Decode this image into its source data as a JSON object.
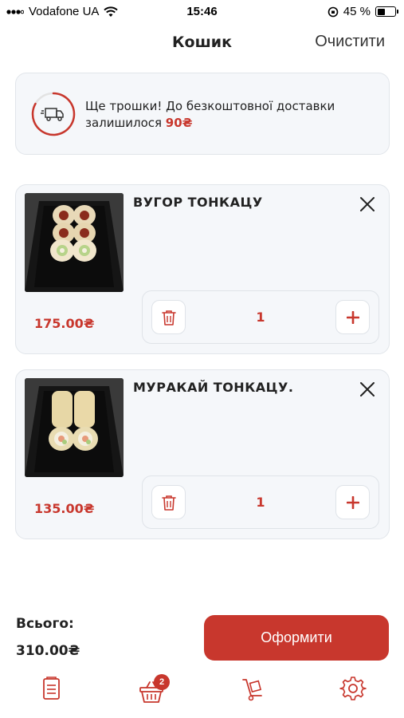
{
  "status_bar": {
    "carrier": "Vodafone UA",
    "time": "15:46",
    "battery_percent": "45 %",
    "battery_level": 0.45
  },
  "header": {
    "title": "Кошик",
    "clear_label": "Очистити"
  },
  "delivery_banner": {
    "message": "Ще трошки! До безкоштовної доставки залишилося",
    "remaining": "90₴",
    "icon": "delivery-truck-icon"
  },
  "cart": {
    "items": [
      {
        "name": "ВУГОР ТОНКАЦУ",
        "price": "175.00₴",
        "quantity": "1"
      },
      {
        "name": "МУРАКАЙ ТОНКАЦУ.",
        "price": "135.00₴",
        "quantity": "1"
      }
    ]
  },
  "summary": {
    "total_label": "Всього:",
    "total_value": "310.00₴",
    "checkout_label": "Оформити"
  },
  "bottom_nav": {
    "items": [
      {
        "icon": "menu-list-icon"
      },
      {
        "icon": "basket-icon",
        "badge": "2"
      },
      {
        "icon": "delivery-cart-icon"
      },
      {
        "icon": "gear-icon"
      }
    ]
  },
  "colors": {
    "accent": "#c8372d",
    "card_background": "#f5f7fa",
    "card_border": "#e1e5ea"
  }
}
